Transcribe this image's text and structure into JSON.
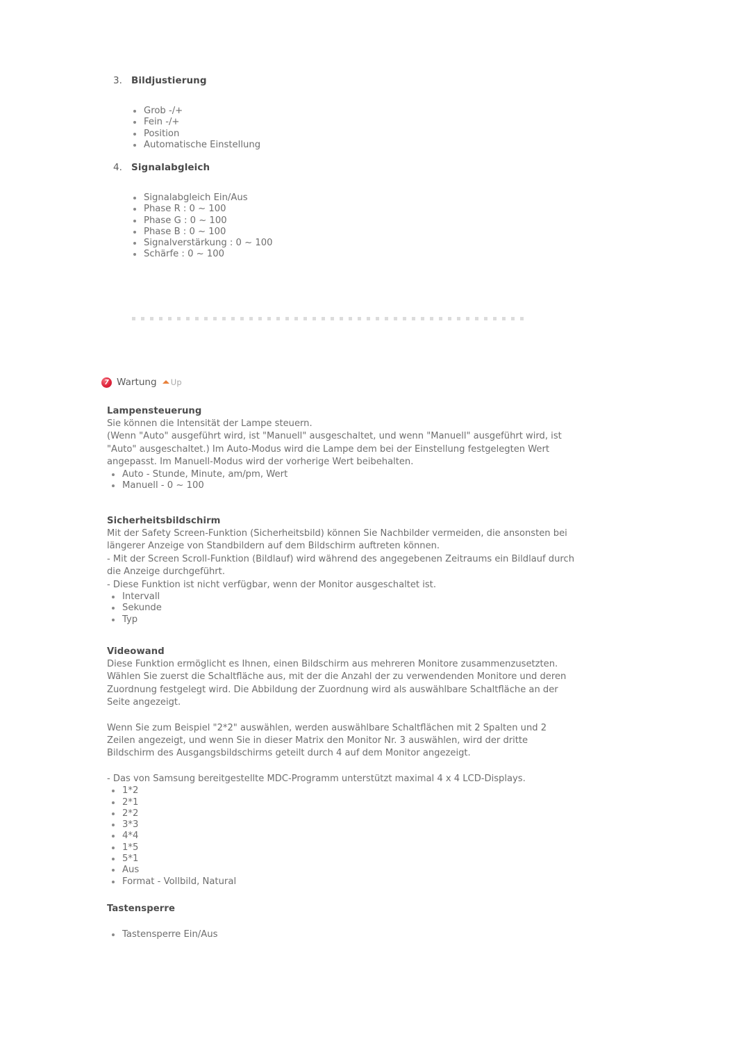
{
  "document": {
    "numbered_sections": [
      {
        "marker": "3.",
        "title": "Bildjustierung",
        "items": [
          "Grob -/+",
          "Fein -/+",
          "Position",
          "Automatische Einstellung"
        ]
      },
      {
        "marker": "4.",
        "title": "Signalabgleich",
        "items": [
          "Signalabgleich Ein/Aus",
          "Phase R : 0 ~ 100",
          "Phase G : 0 ~ 100",
          "Phase B : 0 ~ 100",
          "Signalverstärkung : 0 ~ 100",
          "Schärfe : 0 ~ 100"
        ]
      }
    ],
    "section_header": {
      "badge_number": "7",
      "title": "Wartung",
      "up_label": "Up"
    },
    "subsections": [
      {
        "title": "Lampensteuerung",
        "paragraphs": [
          "Sie können die Intensität der Lampe steuern.",
          "(Wenn \"Auto\" ausgeführt wird, ist \"Manuell\" ausgeschaltet, und wenn \"Manuell\" ausgeführt wird, ist",
          "\"Auto\" ausgeschaltet.) Im Auto-Modus wird die Lampe dem bei der Einstellung festgelegten Wert",
          "angepasst. Im Manuell-Modus wird der vorherige Wert beibehalten."
        ],
        "items": [
          "Auto - Stunde, Minute, am/pm, Wert",
          "Manuell - 0 ~ 100"
        ]
      },
      {
        "title": "Sicherheitsbildschirm",
        "paragraphs": [
          "Mit der Safety Screen-Funktion (Sicherheitsbild) können Sie Nachbilder vermeiden, die ansonsten bei",
          "längerer Anzeige von Standbildern auf dem Bildschirm auftreten können.",
          "- Mit der Screen Scroll-Funktion (Bildlauf) wird während des angegebenen Zeitraums ein Bildlauf durch",
          "die Anzeige durchgeführt.",
          "- Diese Funktion ist nicht verfügbar, wenn der Monitor ausgeschaltet ist."
        ],
        "items": [
          "Intervall",
          "Sekunde",
          "Typ"
        ]
      },
      {
        "title": "Videowand",
        "paragraphs": [
          "Diese Funktion ermöglicht es Ihnen, einen Bildschirm aus mehreren Monitore zusammenzusetzten.",
          "Wählen Sie zuerst die Schaltfläche aus, mit der die Anzahl der zu verwendenden Monitore und deren",
          "Zuordnung festgelegt wird. Die Abbildung der Zuordnung wird als auswählbare Schaltfläche an der",
          "Seite angezeigt."
        ],
        "paragraphs2": [
          "Wenn Sie zum Beispiel \"2*2\" auswählen, werden auswählbare Schaltflächen mit 2 Spalten und 2",
          "Zeilen angezeigt, und wenn Sie in dieser Matrix den Monitor Nr. 3 auswählen, wird der dritte",
          "Bildschirm des Ausgangsbildschirms geteilt durch 4 auf dem Monitor angezeigt."
        ],
        "paragraphs3": [
          "- Das von Samsung bereitgestellte MDC-Programm unterstützt maximal 4 x 4 LCD-Displays."
        ],
        "items": [
          "1*2",
          "2*1",
          "2*2",
          "3*3",
          "4*4",
          "1*5",
          "5*1",
          "Aus",
          "Format - Vollbild, Natural"
        ]
      },
      {
        "title": "Tastensperre",
        "items": [
          "Tastensperre Ein/Aus"
        ]
      }
    ]
  },
  "colors": {
    "badge_red": "#e0263c",
    "up_arrow_orange": "#e8803a",
    "heading": "#4d4d4d",
    "body_text": "#6e6e6e",
    "divider": "#dcdcdc"
  }
}
